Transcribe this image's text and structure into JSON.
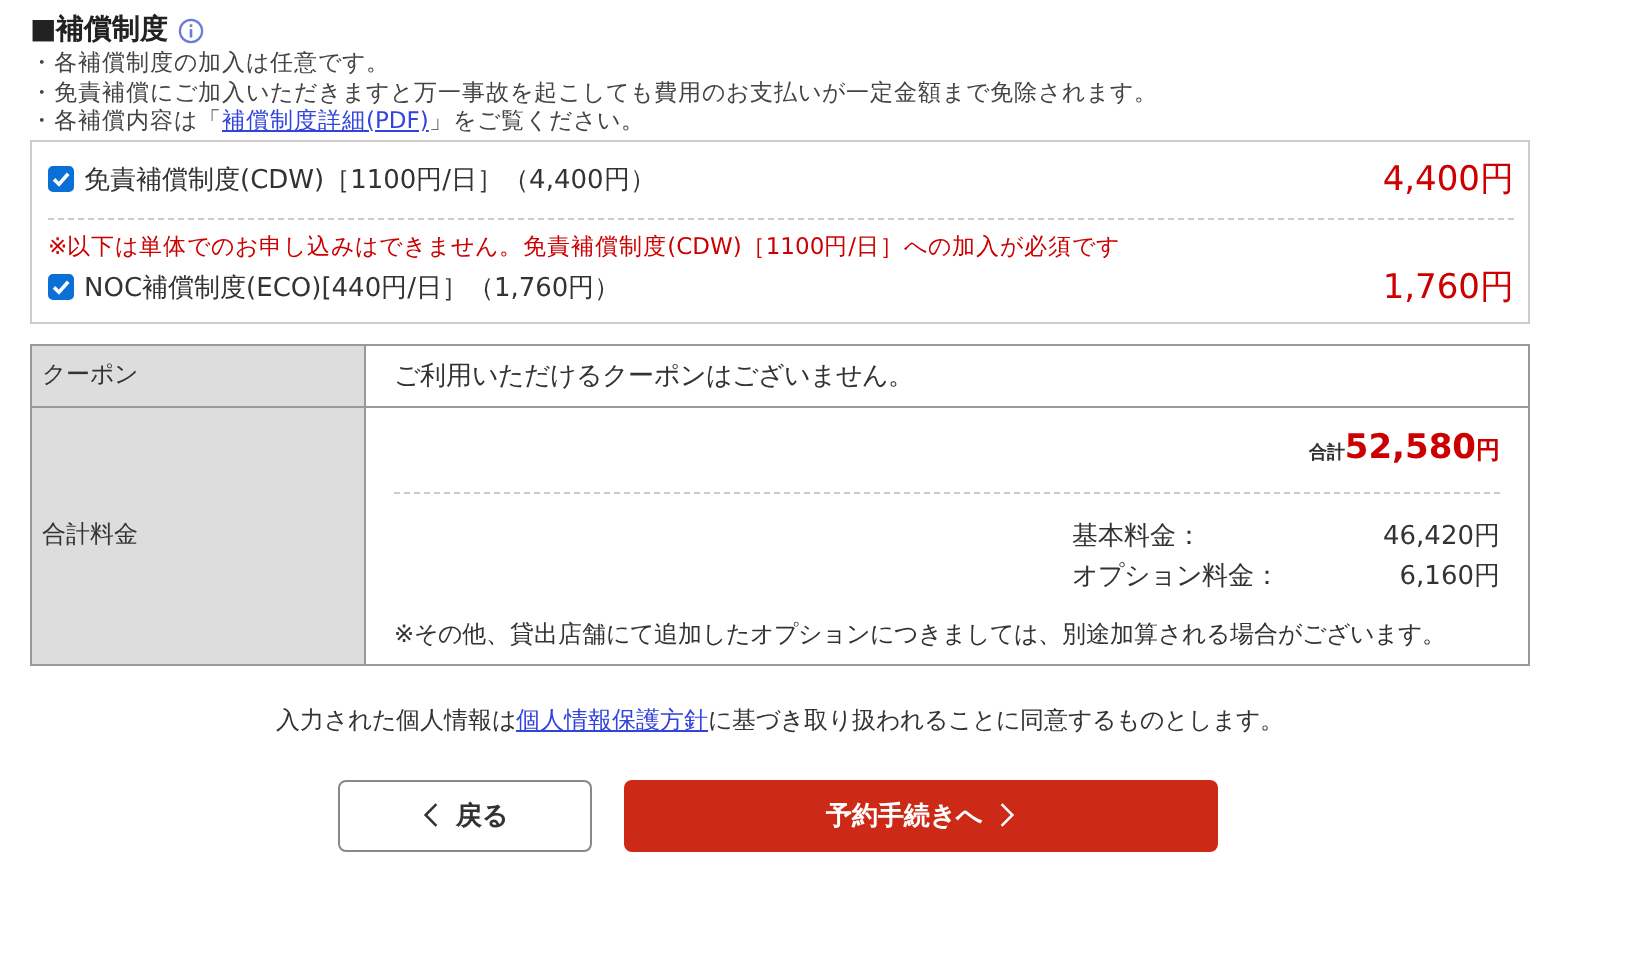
{
  "section": {
    "title": "■補償制度",
    "notes": [
      {
        "text": "・各補償制度の加入は任意です。"
      },
      {
        "text": "・免責補償にご加入いただきますと万一事故を起こしても費用のお支払いが一定金額まで免除されます。"
      },
      {
        "text": "・各補償内容は「",
        "link": "補償制度詳細(PDF)",
        "after": "」をご覧ください。"
      }
    ]
  },
  "options": [
    {
      "label": "免責補償制度(CDW)［1100円/日］（4,400円）",
      "price": "4,400円",
      "checked": true
    },
    {
      "label": "NOC補償制度(ECO)[440円/日］（1,760円）",
      "price": "1,760円",
      "checked": true,
      "warning": "※以下は単体でのお申し込みはできません。免責補償制度(CDW)［1100円/日］への加入が必須です"
    }
  ],
  "coupon": {
    "label": "クーポン",
    "value": "ご利用いただけるクーポンはございません。"
  },
  "total": {
    "label": "合計料金",
    "total_label": "合計",
    "total_value": "52,580",
    "total_unit": "円",
    "lines": [
      {
        "label": "基本料金：",
        "value": "46,420円"
      },
      {
        "label": "オプション料金：",
        "value": "6,160円"
      }
    ],
    "note": "※その他、貸出店舗にて追加したオプションにつきましては、別途加算される場合がございます。"
  },
  "agreement": {
    "before": "入力された個人情報は",
    "link": "個人情報保護方針",
    "after": "に基づき取り扱われることに同意するものとします。"
  },
  "buttons": {
    "back": "戻る",
    "next": "予約手続きへ"
  }
}
